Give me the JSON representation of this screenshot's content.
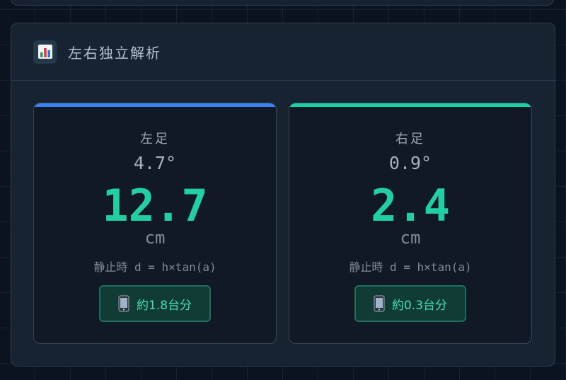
{
  "panel": {
    "title": "左右独立解析",
    "icon": "bar-chart-icon"
  },
  "left": {
    "label": "左足",
    "angle": "4.7°",
    "value": "12.7",
    "unit": "cm",
    "formula": "静止時 d = h×tan(a)",
    "badge": "約1.8台分",
    "accent": "#3b82f6"
  },
  "right": {
    "label": "右足",
    "angle": "0.9°",
    "value": "2.4",
    "unit": "cm",
    "formula": "静止時 d = h×tan(a)",
    "badge": "約0.3台分",
    "accent": "#19d3a2"
  },
  "colors": {
    "value": "#22cfa3",
    "badge_text": "#3fe0b4"
  },
  "badge_icon": "smartphone-icon"
}
